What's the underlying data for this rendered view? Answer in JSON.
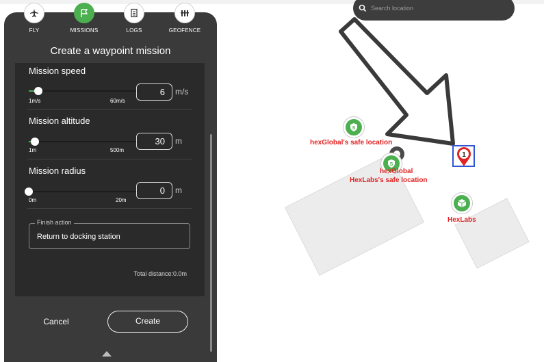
{
  "nav": {
    "items": [
      {
        "label": "FLY",
        "icon": "airplane-icon",
        "active": false
      },
      {
        "label": "MISSIONS",
        "icon": "flag-icon",
        "active": true
      },
      {
        "label": "LOGS",
        "icon": "document-icon",
        "active": false
      },
      {
        "label": "GEOFENCE",
        "icon": "fence-icon",
        "active": false
      }
    ]
  },
  "panel": {
    "title": "Create a waypoint mission",
    "speed": {
      "label": "Mission speed",
      "min_label": "1m/s",
      "max_label": "60m/s",
      "value": "6",
      "unit": "m/s",
      "fraction": 0.085
    },
    "altitude": {
      "label": "Mission altitude",
      "min_label": "1m",
      "max_label": "500m",
      "value": "30",
      "unit": "m",
      "fraction": 0.058
    },
    "radius": {
      "label": "Mission radius",
      "min_label": "0m",
      "max_label": "20m",
      "value": "0",
      "unit": "m",
      "fraction": 0.0
    },
    "finish_action": {
      "legend": "Finish action",
      "value": "Return to docking station"
    },
    "total_distance": "Total distance:0.0m",
    "cancel_label": "Cancel",
    "create_label": "Create"
  },
  "map": {
    "search_placeholder": "Search location",
    "markers": {
      "hexglobal_safe": "hexGlobal's safe location",
      "hexglobal": "hexGlobal",
      "hexlabs_safe": "HexLabs's safe location",
      "hexlabs": "HexLabs",
      "waypoint_number": "1"
    }
  },
  "colors": {
    "accent_green": "#4caf50",
    "marker_red": "#e02424",
    "waypoint_border": "#2f55d4",
    "panel_bg": "#3a3a3a"
  }
}
